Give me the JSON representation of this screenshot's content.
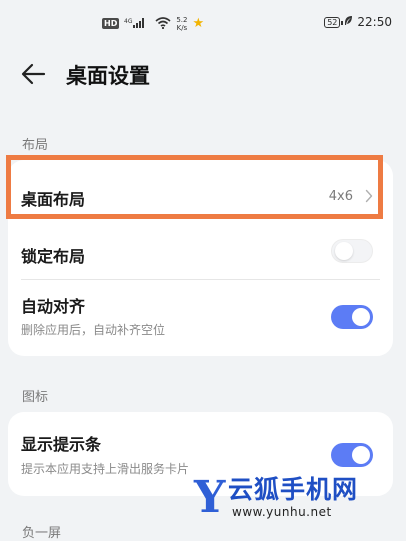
{
  "status_bar": {
    "hd_label": "HD",
    "network_label": "4G",
    "speed_value": "5.2",
    "speed_unit": "K/s",
    "battery_level": "52",
    "time": "22:50",
    "icons": [
      "hd-icon",
      "signal-icon",
      "wifi-icon",
      "star-icon",
      "battery-icon",
      "leaf-icon"
    ]
  },
  "header": {
    "title": "桌面设置",
    "back_icon": "arrow-left-icon"
  },
  "sections": {
    "layout_label": "布局",
    "icons_label": "图标",
    "minus_one_label": "负一屏"
  },
  "layout_card": {
    "desktop_layout": {
      "title": "桌面布局",
      "value": "4x6"
    },
    "lock_layout": {
      "title": "锁定布局",
      "enabled": false
    },
    "auto_align": {
      "title": "自动对齐",
      "subtitle": "删除应用后，自动补齐空位",
      "enabled": true
    }
  },
  "icons_card": {
    "show_hint_bar": {
      "title": "显示提示条",
      "subtitle": "提示本应用支持上滑出服务卡片",
      "enabled": true
    }
  },
  "watermark": {
    "letter": "Y",
    "name": "云狐手机网",
    "url": "www.yunhu.net"
  },
  "colors": {
    "background": "#f1f3f5",
    "card": "#ffffff",
    "accent": "#5c7cf5",
    "highlight": "#ee7b43",
    "watermark_blue": "#1f4fc4"
  }
}
